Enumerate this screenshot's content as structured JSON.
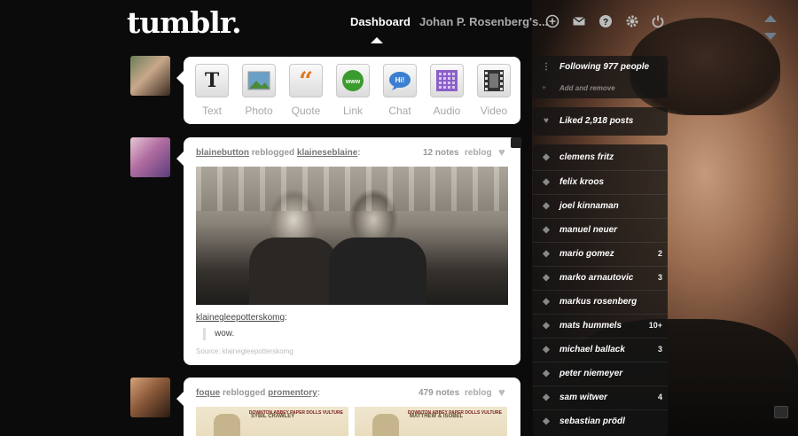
{
  "header": {
    "logo": "tumblr.",
    "nav_dashboard": "Dashboard",
    "nav_user": "Johan P. Rosenberg's..."
  },
  "post_types": [
    {
      "label": "Text",
      "icon": "text-icon"
    },
    {
      "label": "Photo",
      "icon": "photo-icon"
    },
    {
      "label": "Quote",
      "icon": "quote-icon"
    },
    {
      "label": "Link",
      "icon": "link-icon"
    },
    {
      "label": "Chat",
      "icon": "chat-icon"
    },
    {
      "label": "Audio",
      "icon": "audio-icon"
    },
    {
      "label": "Video",
      "icon": "video-icon"
    }
  ],
  "post1": {
    "user": "blainebutton",
    "action": "reblogged",
    "source_user": "klaineseblaine",
    "notes": "12 notes",
    "reblog": "reblog",
    "quote_user": "klaineglee​potterskomg",
    "quote_text": "wow.",
    "source_line": "Source: klaineglee​potterskomg"
  },
  "post2": {
    "user": "foque",
    "action": "reblogged",
    "source_user": "promentory",
    "notes": "479 notes",
    "reblog": "reblog",
    "thumb1_title": "SYBIL CRAWLEY",
    "thumb1_brand": "DOWNTON ABBEY PAPER DOLLS VULTURE",
    "thumb2_title": "MATTHEW & ISOBEL",
    "thumb2_brand": "DOWNTON ABBEY PAPER DOLLS VULTURE"
  },
  "sidebar": {
    "following": "Following 977 people",
    "add_remove": "Add and remove",
    "liked": "Liked 2,918 posts",
    "tags": [
      {
        "label": "clemens fritz",
        "count": ""
      },
      {
        "label": "felix kroos",
        "count": ""
      },
      {
        "label": "joel kinnaman",
        "count": ""
      },
      {
        "label": "manuel neuer",
        "count": ""
      },
      {
        "label": "mario gomez",
        "count": "2"
      },
      {
        "label": "marko arnautovic",
        "count": "3"
      },
      {
        "label": "markus rosenberg",
        "count": ""
      },
      {
        "label": "mats hummels",
        "count": "10+"
      },
      {
        "label": "michael ballack",
        "count": "3"
      },
      {
        "label": "peter niemeyer",
        "count": ""
      },
      {
        "label": "sam witwer",
        "count": "4"
      },
      {
        "label": "sebastian prödl",
        "count": ""
      }
    ]
  },
  "colors": {
    "background": "#0b0b0b",
    "panel": "#ffffff",
    "scroll_arrows": "#6d7d8c"
  }
}
